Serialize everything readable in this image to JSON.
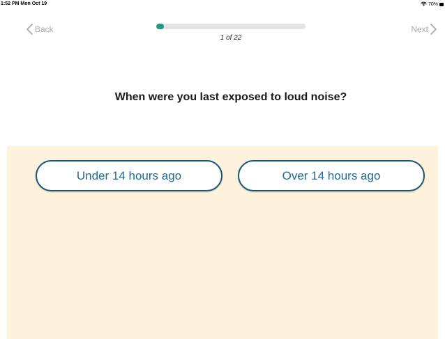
{
  "status_bar": {
    "time": "1:52 PM  Mon Oct 19",
    "battery_percent": "70%",
    "wifi_icon": "wifi-icon",
    "battery_icon": "battery-icon"
  },
  "nav": {
    "back_label": "Back",
    "next_label": "Next"
  },
  "progress": {
    "label": "1 of 22",
    "current": 1,
    "total": 22,
    "fill_color": "#1f9a84"
  },
  "question": {
    "text": "When were you last exposed to loud noise?"
  },
  "answers": [
    {
      "label": "Under 14 hours ago"
    },
    {
      "label": "Over 14 hours ago"
    }
  ],
  "colors": {
    "answer_background": "#fef2dd",
    "button_border": "#1b5777",
    "button_text": "#1d6a93",
    "nav_disabled": "#a9a9a9"
  }
}
